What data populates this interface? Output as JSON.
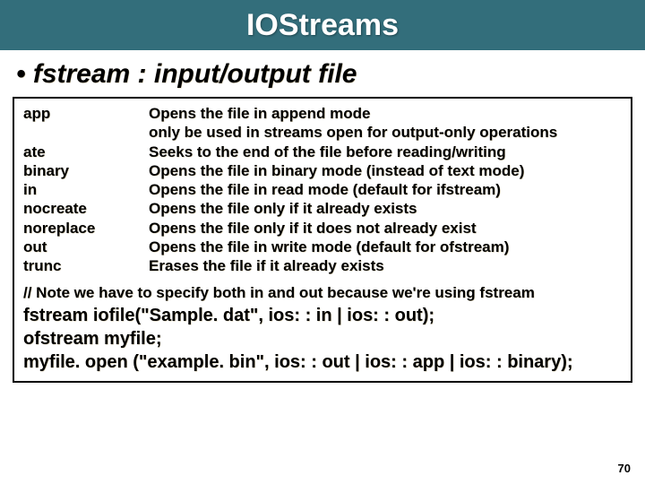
{
  "title": "IOStreams",
  "subheading": "• fstream : input/output  file",
  "flags": [
    {
      "k": "app",
      "v": "Opens the file in append mode"
    },
    {
      "k": "",
      "v": "only be used in streams open for output-only operations"
    },
    {
      "k": "ate",
      "v": "Seeks to the end of the file before reading/writing"
    },
    {
      "k": "binary",
      "v": "Opens the file in binary mode (instead of text mode)"
    },
    {
      "k": "in",
      "v": "Opens the file in read mode (default for ifstream)"
    },
    {
      "k": "nocreate",
      "v": "Opens the file only if it already exists"
    },
    {
      "k": "noreplace",
      "v": "Opens the file only if it does not already exist"
    },
    {
      "k": "out",
      "v": "Opens the file in write mode (default for ofstream)"
    },
    {
      "k": "trunc",
      "v": "Erases the file if it already exists"
    }
  ],
  "note": "// Note we have to specify both in and out because we're using fstream",
  "code": [
    "fstream iofile(\"Sample. dat\", ios: : in | ios: : out);",
    "ofstream myfile;",
    "myfile. open (\"example. bin\", ios: : out | ios: : app | ios: : binary);"
  ],
  "page": "70"
}
